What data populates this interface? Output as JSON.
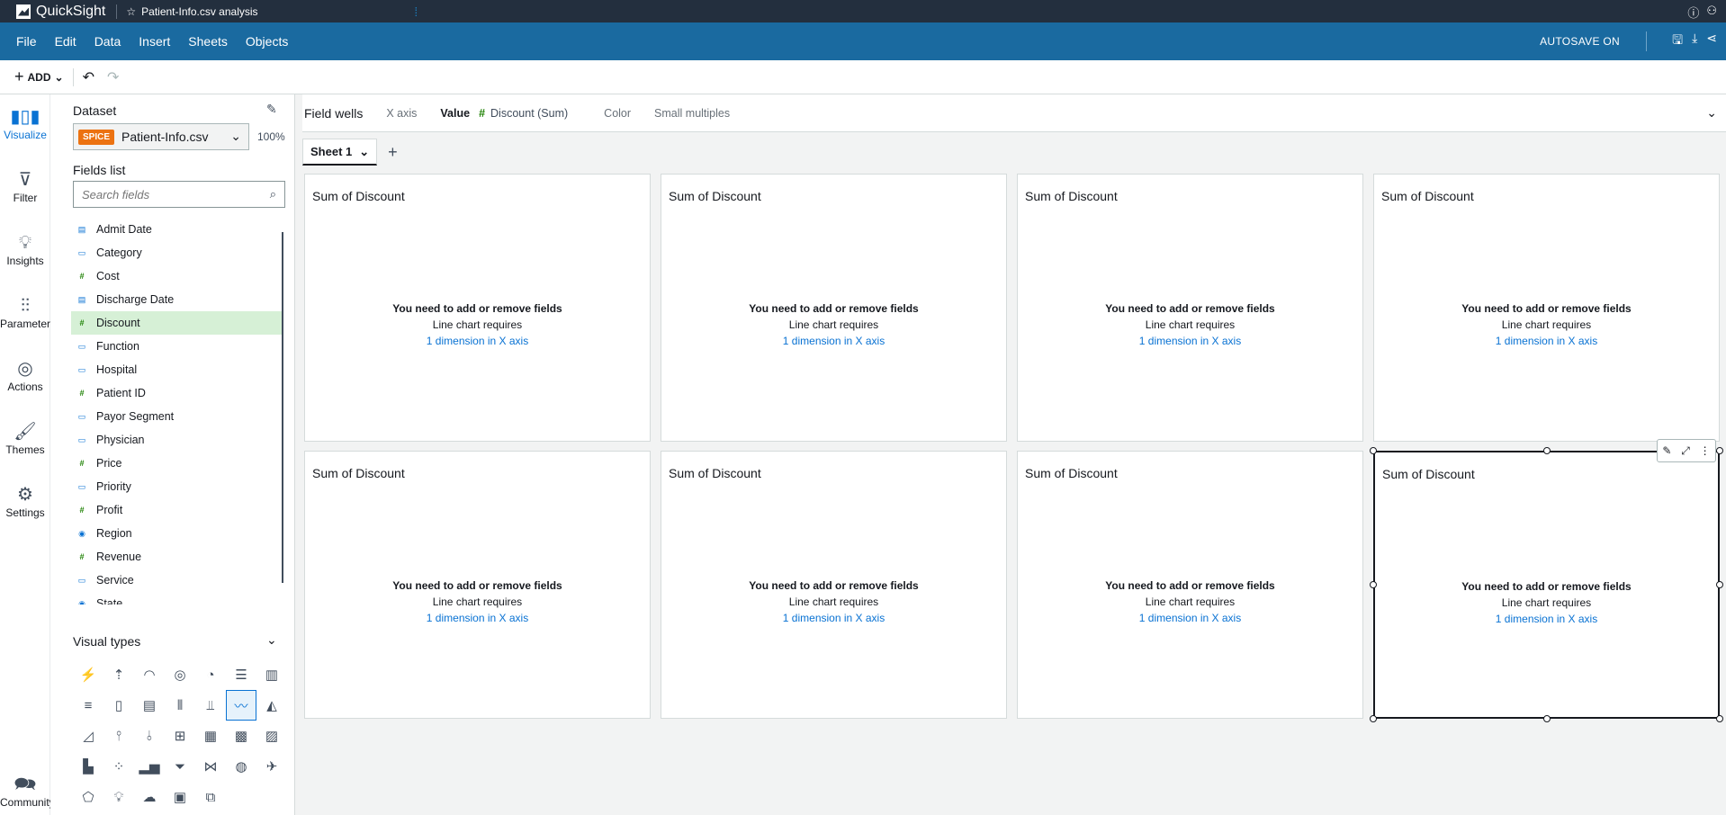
{
  "topbar": {
    "app_name": "QuickSight",
    "analysis_name": "Patient-Info.csv analysis"
  },
  "menubar": {
    "items": [
      "File",
      "Edit",
      "Data",
      "Insert",
      "Sheets",
      "Objects"
    ],
    "autosave": "AUTOSAVE ON"
  },
  "toolbar": {
    "add_label": "ADD"
  },
  "rail": {
    "items": [
      "Visualize",
      "Filter",
      "Insights",
      "Parameters",
      "Actions",
      "Themes",
      "Settings"
    ],
    "community": "Community"
  },
  "panel": {
    "dataset_title": "Dataset",
    "spice_badge": "SPICE",
    "dataset_name": "Patient-Info.csv",
    "spice_pct": "100%",
    "fields_title": "Fields list",
    "search_placeholder": "Search fields",
    "fields": [
      {
        "name": "Admit Date",
        "type": "date"
      },
      {
        "name": "Category",
        "type": "dim"
      },
      {
        "name": "Cost",
        "type": "meas"
      },
      {
        "name": "Discharge Date",
        "type": "date"
      },
      {
        "name": "Discount",
        "type": "meas"
      },
      {
        "name": "Function",
        "type": "dim"
      },
      {
        "name": "Hospital",
        "type": "dim"
      },
      {
        "name": "Patient ID",
        "type": "meas"
      },
      {
        "name": "Payor Segment",
        "type": "dim"
      },
      {
        "name": "Physician",
        "type": "dim"
      },
      {
        "name": "Price",
        "type": "meas"
      },
      {
        "name": "Priority",
        "type": "dim"
      },
      {
        "name": "Profit",
        "type": "meas"
      },
      {
        "name": "Region",
        "type": "geo"
      },
      {
        "name": "Revenue",
        "type": "meas"
      },
      {
        "name": "Service",
        "type": "dim"
      },
      {
        "name": "State",
        "type": "geo"
      }
    ],
    "selected_field": "Discount",
    "visual_types_title": "Visual types"
  },
  "wells": {
    "label": "Field wells",
    "x_axis": "X axis",
    "value": "Value",
    "value_field": "Discount (Sum)",
    "color": "Color",
    "small_multiples": "Small multiples"
  },
  "sheets": {
    "tabs": [
      "Sheet 1"
    ]
  },
  "visual": {
    "title": "Sum of Discount",
    "msg1": "You need to add or remove fields",
    "msg2": "Line chart requires",
    "msg3": "1 dimension in X axis"
  }
}
